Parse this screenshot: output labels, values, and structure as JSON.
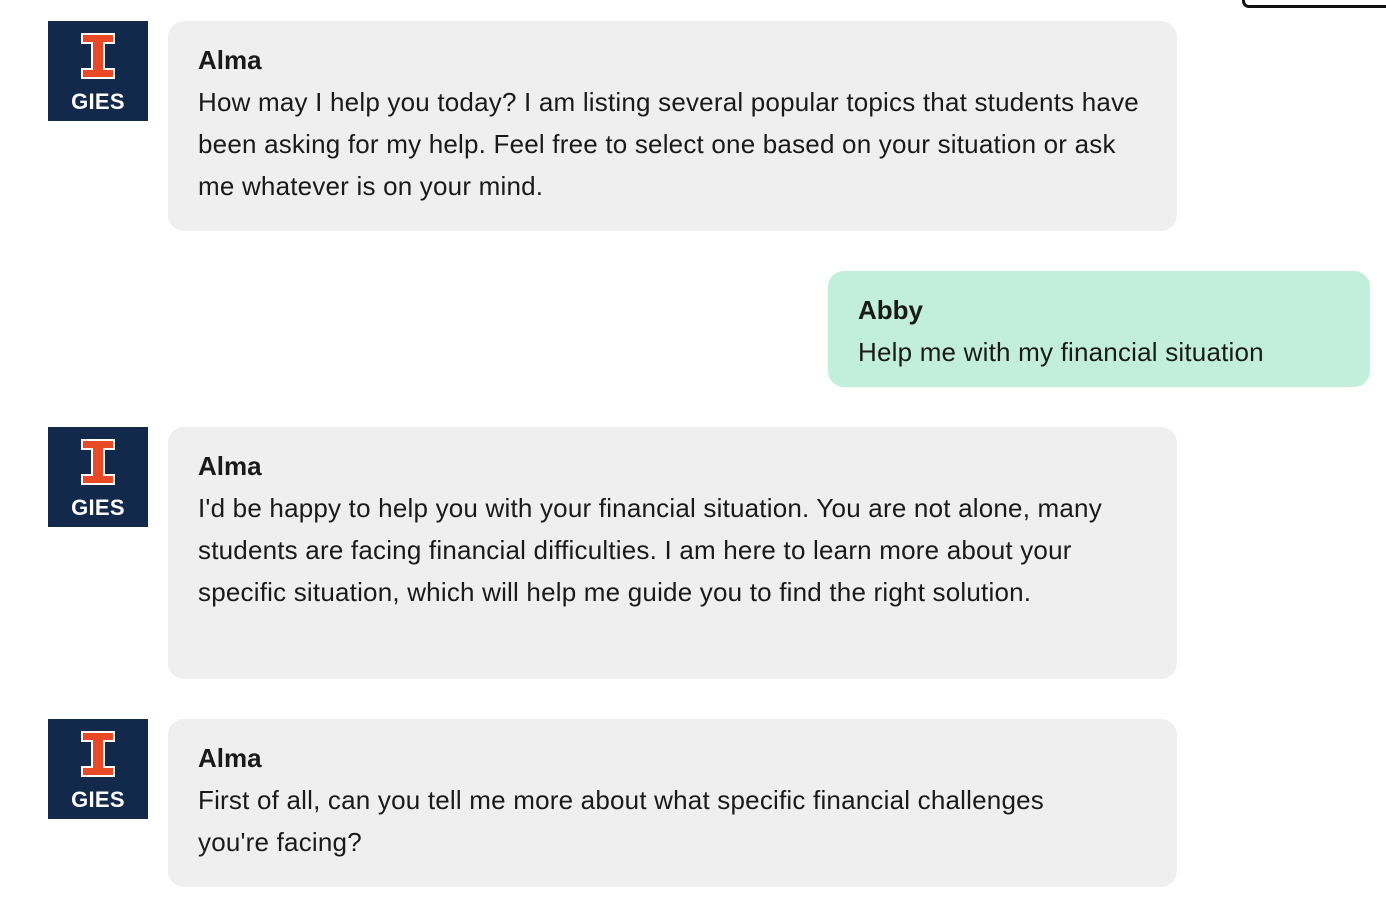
{
  "messages": [
    {
      "sender": "Alma",
      "role": "bot",
      "avatar_text": "GIES",
      "text": "How may I help you today? I am listing several popular topics that students have been asking for my help. Feel free to select one based on your situation or ask me whatever is on your mind."
    },
    {
      "sender": "Abby",
      "role": "user",
      "text": "Help me with my financial situation"
    },
    {
      "sender": "Alma",
      "role": "bot",
      "avatar_text": "GIES",
      "text": "I'd be happy to help you with your financial situation. You are not alone, many students are facing financial difficulties. I am here to learn more about your specific situation, which will help me guide you to find the right solution."
    },
    {
      "sender": "Alma",
      "role": "bot",
      "avatar_text": "GIES",
      "text": "First of all, can you tell me more about what specific financial challenges you're facing?"
    }
  ],
  "colors": {
    "avatar_bg": "#13294b",
    "logo_orange": "#e84a27",
    "bot_bubble": "#efefef",
    "user_bubble": "#c2eedc"
  },
  "icons": {
    "avatar_logo": "block-i-logo-icon"
  }
}
